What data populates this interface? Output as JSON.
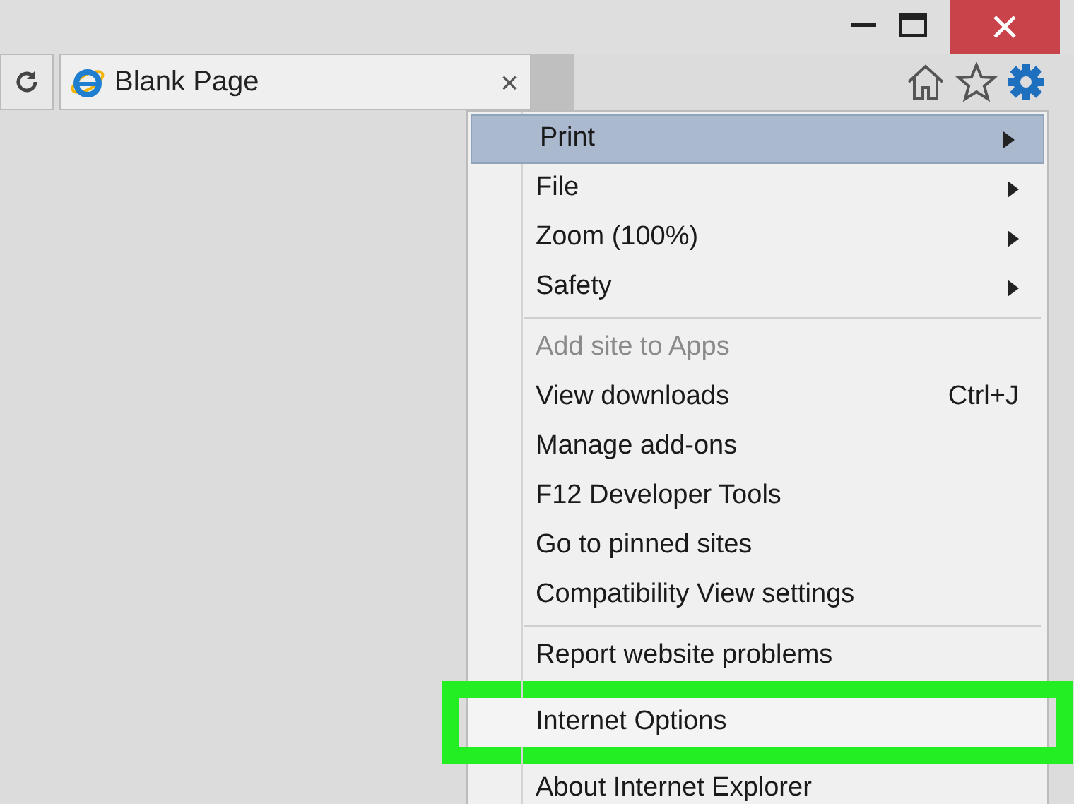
{
  "tab": {
    "title": "Blank Page",
    "close": "×"
  },
  "menu": [
    {
      "kind": "item",
      "label": "Print",
      "submenu": true,
      "selected": true,
      "disabled": false,
      "callout": false
    },
    {
      "kind": "item",
      "label": "File",
      "submenu": true,
      "selected": false,
      "disabled": false,
      "callout": false
    },
    {
      "kind": "item",
      "label": "Zoom (100%)",
      "submenu": true,
      "selected": false,
      "disabled": false,
      "callout": false
    },
    {
      "kind": "item",
      "label": "Safety",
      "submenu": true,
      "selected": false,
      "disabled": false,
      "callout": false
    },
    {
      "kind": "separator"
    },
    {
      "kind": "item",
      "label": "Add site to Apps",
      "submenu": false,
      "selected": false,
      "disabled": true,
      "callout": false
    },
    {
      "kind": "item",
      "label": "View downloads",
      "shortcut": "Ctrl+J",
      "submenu": false,
      "selected": false,
      "disabled": false,
      "callout": false
    },
    {
      "kind": "item",
      "label": "Manage add-ons",
      "submenu": false,
      "selected": false,
      "disabled": false,
      "callout": false
    },
    {
      "kind": "item",
      "label": "F12 Developer Tools",
      "submenu": false,
      "selected": false,
      "disabled": false,
      "callout": false
    },
    {
      "kind": "item",
      "label": "Go to pinned sites",
      "submenu": false,
      "selected": false,
      "disabled": false,
      "callout": false
    },
    {
      "kind": "item",
      "label": "Compatibility View settings",
      "submenu": false,
      "selected": false,
      "disabled": false,
      "callout": false
    },
    {
      "kind": "separator"
    },
    {
      "kind": "item",
      "label": "Report website problems",
      "submenu": false,
      "selected": false,
      "disabled": false,
      "callout": false
    },
    {
      "kind": "item",
      "label": "Internet Options",
      "submenu": false,
      "selected": false,
      "disabled": false,
      "callout": true
    },
    {
      "kind": "item",
      "label": "About Internet Explorer",
      "submenu": false,
      "selected": false,
      "disabled": false,
      "callout": false
    }
  ]
}
